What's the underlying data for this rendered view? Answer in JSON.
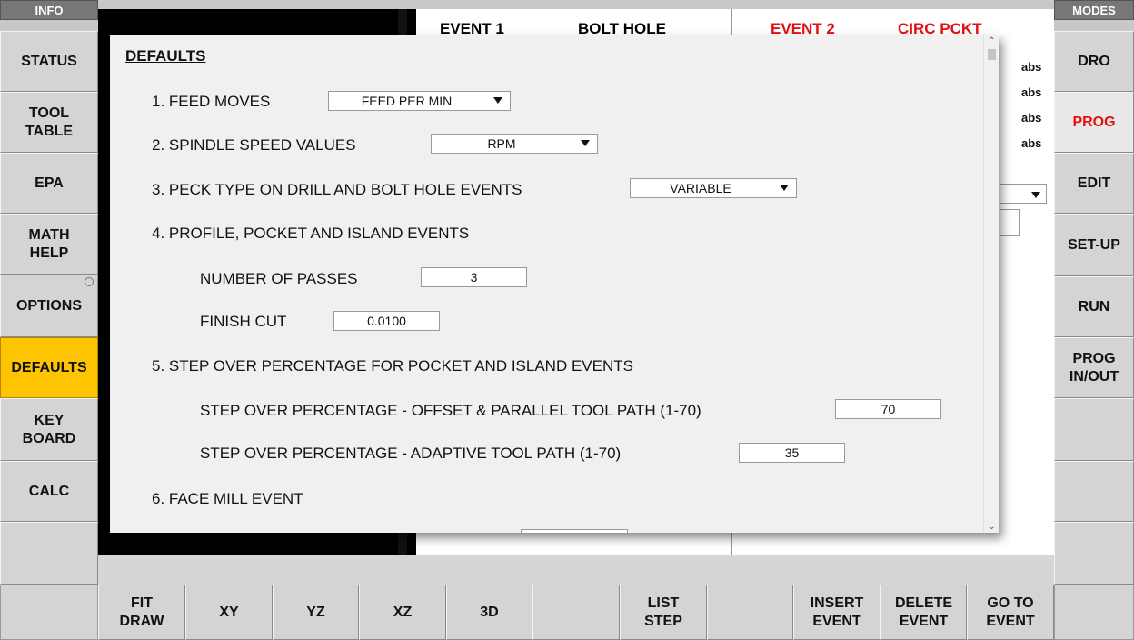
{
  "left_panel": {
    "header": "INFO",
    "buttons": [
      "STATUS",
      "TOOL\nTABLE",
      "EPA",
      "MATH\nHELP",
      "OPTIONS",
      "DEFAULTS",
      "KEY\nBOARD",
      "CALC"
    ]
  },
  "right_panel": {
    "header": "MODES",
    "buttons": [
      "DRO",
      "PROG",
      "EDIT",
      "SET-UP",
      "RUN",
      "PROG\nIN/OUT"
    ]
  },
  "background": {
    "event1_title": "EVENT 1",
    "event1_type": "BOLT HOLE",
    "event2_title": "EVENT 2",
    "event2_type": "CIRC PCKT",
    "abs_labels": [
      "abs",
      "abs",
      "abs",
      "abs"
    ]
  },
  "bottom_bar": {
    "buttons": [
      "FIT\nDRAW",
      "XY",
      "YZ",
      "XZ",
      "3D",
      "",
      "LIST\nSTEP",
      "",
      "INSERT\nEVENT",
      "DELETE\nEVENT",
      "GO TO\nEVENT"
    ]
  },
  "dialog": {
    "title": "DEFAULTS",
    "feed_moves": {
      "label": "1. FEED MOVES",
      "value": "FEED PER MIN"
    },
    "spindle_speed": {
      "label": "2. SPINDLE SPEED VALUES",
      "value": "RPM"
    },
    "peck_type": {
      "label": "3. PECK TYPE ON DRILL AND BOLT HOLE EVENTS",
      "value": "VARIABLE"
    },
    "profile_section": "4. PROFILE, POCKET AND ISLAND EVENTS",
    "number_of_passes": {
      "label": "NUMBER OF PASSES",
      "value": "3"
    },
    "finish_cut": {
      "label": "FINISH CUT",
      "value": "0.0100"
    },
    "step_over_section": "5. STEP OVER PERCENTAGE FOR POCKET AND ISLAND EVENTS",
    "step_over_offset": {
      "label": "STEP OVER PERCENTAGE - OFFSET & PARALLEL TOOL PATH (1-70)",
      "value": "70"
    },
    "step_over_adaptive": {
      "label": "STEP OVER PERCENTAGE - ADAPTIVE TOOL PATH (1-70)",
      "value": "35"
    },
    "face_mill_section": "6. FACE MILL EVENT"
  },
  "colors": {
    "active_tab": "#ffc400",
    "prog_text": "#e41010",
    "event2_text": "#e41010"
  }
}
